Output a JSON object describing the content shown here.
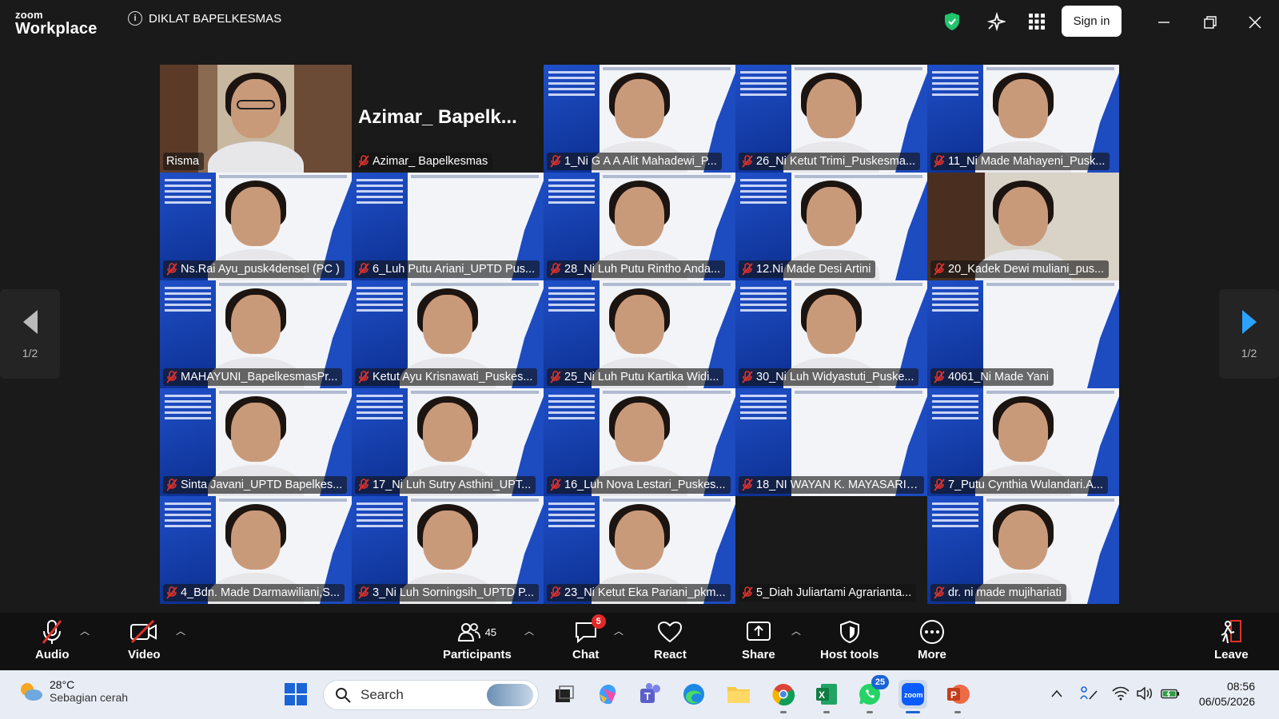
{
  "titlebar": {
    "logo_line1": "zoom",
    "logo_line2": "Workplace",
    "meeting_title": "DIKLAT BAPELKESMAS",
    "signin_label": "Sign in"
  },
  "pager": {
    "left": "1/2",
    "right": "1/2"
  },
  "participants": [
    {
      "name": "Risma",
      "kind": "room",
      "active": true,
      "muted": false
    },
    {
      "name": "Azimar_ Bapelkesmas",
      "big_name": "Azimar_ Bapelk...",
      "kind": "name-only",
      "muted": true
    },
    {
      "name": "1_Ni G A A Alit Mahadewi_P...",
      "kind": "bg",
      "muted": true
    },
    {
      "name": "26_Ni Ketut Trimi_Puskesma...",
      "kind": "bg",
      "muted": true
    },
    {
      "name": "11_Ni Made Mahayeni_Pusk...",
      "kind": "bg",
      "muted": true
    },
    {
      "name": "Ns.Rai Ayu_pusk4densel (PC )",
      "kind": "bg",
      "muted": true
    },
    {
      "name": "6_Luh Putu Ariani_UPTD Pus...",
      "kind": "bg-empty",
      "muted": true
    },
    {
      "name": "28_Ni Luh Putu Rintho Anda...",
      "kind": "bg",
      "muted": true
    },
    {
      "name": "12.Ni Made Desi Artini",
      "kind": "bg",
      "muted": true
    },
    {
      "name": "20_Kadek Dewi muliani_pus...",
      "kind": "room2",
      "muted": true
    },
    {
      "name": "MAHAYUNI_BapelkesmasPr...",
      "kind": "bg",
      "muted": true
    },
    {
      "name": "Ketut Ayu Krisnawati_Puskes...",
      "kind": "bg",
      "muted": true
    },
    {
      "name": "25_Ni Luh Putu Kartika Widi...",
      "kind": "bg",
      "muted": true
    },
    {
      "name": "30_Ni Luh Widyastuti_Puske...",
      "kind": "bg",
      "muted": true
    },
    {
      "name": "4061_Ni Made Yani",
      "kind": "bg-empty",
      "muted": true
    },
    {
      "name": "Sinta Javani_UPTD Bapelkes...",
      "kind": "bg",
      "muted": true
    },
    {
      "name": "17_Ni Luh Sutry Asthini_UPT...",
      "kind": "bg",
      "muted": true
    },
    {
      "name": "16_Luh Nova Lestari_Puskes...",
      "kind": "bg",
      "muted": true
    },
    {
      "name": "18_NI WAYAN K. MAYASARI_...",
      "kind": "bg-empty",
      "muted": true
    },
    {
      "name": "7_Putu Cynthia Wulandari.A...",
      "kind": "bg",
      "muted": true
    },
    {
      "name": "4_Bdn. Made Darmawiliani,S...",
      "kind": "bg",
      "muted": true
    },
    {
      "name": "3_Ni Luh Sorningsih_UPTD P...",
      "kind": "bg",
      "muted": true
    },
    {
      "name": "23_Ni Ketut Eka Pariani_pkm...",
      "kind": "bg",
      "muted": true
    },
    {
      "name": "5_Diah Juliartami Agrarianta...",
      "kind": "blank",
      "muted": true
    },
    {
      "name": "dr. ni made mujihariati",
      "kind": "bg",
      "muted": true
    }
  ],
  "toolbar": {
    "audio": "Audio",
    "video": "Video",
    "participants": "Participants",
    "participants_count": "45",
    "chat": "Chat",
    "chat_badge": "5",
    "react": "React",
    "share": "Share",
    "host_tools": "Host tools",
    "more": "More",
    "leave": "Leave"
  },
  "taskbar": {
    "temperature": "28°C",
    "weather_desc": "Sebagian cerah",
    "search_placeholder": "Search",
    "whatsapp_badge": "25",
    "time": "08:56",
    "date": "06/05/2026"
  },
  "colors": {
    "active_speaker": "#20c56b",
    "mute_red": "#e0312c",
    "accent_blue": "#1a64d6"
  }
}
